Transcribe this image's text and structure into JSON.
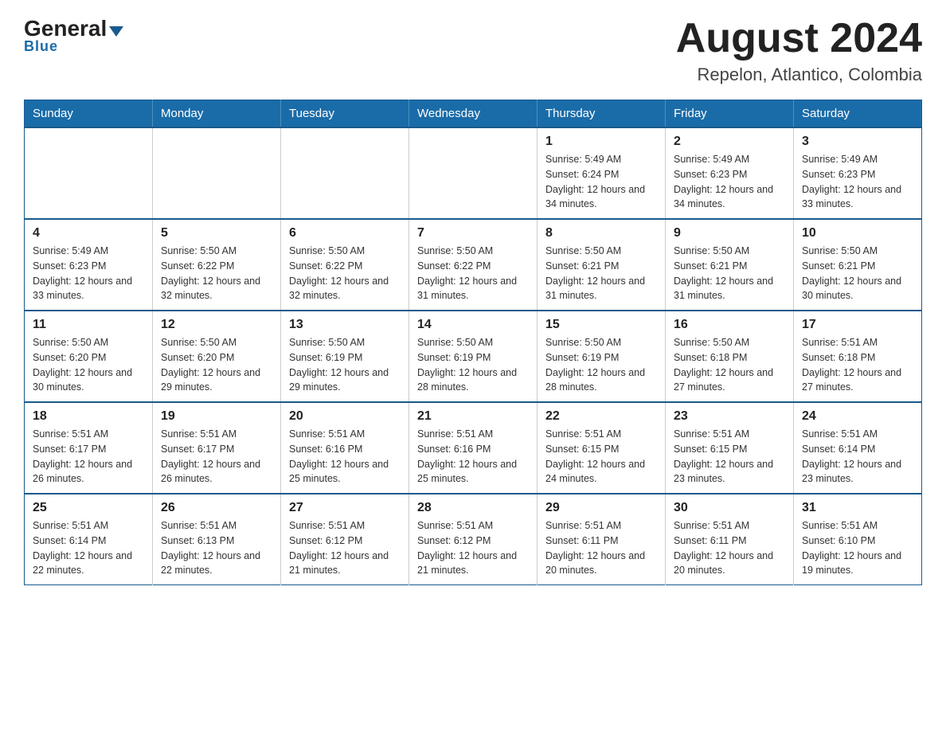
{
  "header": {
    "logo_general": "General",
    "logo_blue": "Blue",
    "month_title": "August 2024",
    "location": "Repelon, Atlantico, Colombia"
  },
  "weekdays": [
    "Sunday",
    "Monday",
    "Tuesday",
    "Wednesday",
    "Thursday",
    "Friday",
    "Saturday"
  ],
  "weeks": [
    [
      {
        "day": "",
        "sunrise": "",
        "sunset": "",
        "daylight": ""
      },
      {
        "day": "",
        "sunrise": "",
        "sunset": "",
        "daylight": ""
      },
      {
        "day": "",
        "sunrise": "",
        "sunset": "",
        "daylight": ""
      },
      {
        "day": "",
        "sunrise": "",
        "sunset": "",
        "daylight": ""
      },
      {
        "day": "1",
        "sunrise": "Sunrise: 5:49 AM",
        "sunset": "Sunset: 6:24 PM",
        "daylight": "Daylight: 12 hours and 34 minutes."
      },
      {
        "day": "2",
        "sunrise": "Sunrise: 5:49 AM",
        "sunset": "Sunset: 6:23 PM",
        "daylight": "Daylight: 12 hours and 34 minutes."
      },
      {
        "day": "3",
        "sunrise": "Sunrise: 5:49 AM",
        "sunset": "Sunset: 6:23 PM",
        "daylight": "Daylight: 12 hours and 33 minutes."
      }
    ],
    [
      {
        "day": "4",
        "sunrise": "Sunrise: 5:49 AM",
        "sunset": "Sunset: 6:23 PM",
        "daylight": "Daylight: 12 hours and 33 minutes."
      },
      {
        "day": "5",
        "sunrise": "Sunrise: 5:50 AM",
        "sunset": "Sunset: 6:22 PM",
        "daylight": "Daylight: 12 hours and 32 minutes."
      },
      {
        "day": "6",
        "sunrise": "Sunrise: 5:50 AM",
        "sunset": "Sunset: 6:22 PM",
        "daylight": "Daylight: 12 hours and 32 minutes."
      },
      {
        "day": "7",
        "sunrise": "Sunrise: 5:50 AM",
        "sunset": "Sunset: 6:22 PM",
        "daylight": "Daylight: 12 hours and 31 minutes."
      },
      {
        "day": "8",
        "sunrise": "Sunrise: 5:50 AM",
        "sunset": "Sunset: 6:21 PM",
        "daylight": "Daylight: 12 hours and 31 minutes."
      },
      {
        "day": "9",
        "sunrise": "Sunrise: 5:50 AM",
        "sunset": "Sunset: 6:21 PM",
        "daylight": "Daylight: 12 hours and 31 minutes."
      },
      {
        "day": "10",
        "sunrise": "Sunrise: 5:50 AM",
        "sunset": "Sunset: 6:21 PM",
        "daylight": "Daylight: 12 hours and 30 minutes."
      }
    ],
    [
      {
        "day": "11",
        "sunrise": "Sunrise: 5:50 AM",
        "sunset": "Sunset: 6:20 PM",
        "daylight": "Daylight: 12 hours and 30 minutes."
      },
      {
        "day": "12",
        "sunrise": "Sunrise: 5:50 AM",
        "sunset": "Sunset: 6:20 PM",
        "daylight": "Daylight: 12 hours and 29 minutes."
      },
      {
        "day": "13",
        "sunrise": "Sunrise: 5:50 AM",
        "sunset": "Sunset: 6:19 PM",
        "daylight": "Daylight: 12 hours and 29 minutes."
      },
      {
        "day": "14",
        "sunrise": "Sunrise: 5:50 AM",
        "sunset": "Sunset: 6:19 PM",
        "daylight": "Daylight: 12 hours and 28 minutes."
      },
      {
        "day": "15",
        "sunrise": "Sunrise: 5:50 AM",
        "sunset": "Sunset: 6:19 PM",
        "daylight": "Daylight: 12 hours and 28 minutes."
      },
      {
        "day": "16",
        "sunrise": "Sunrise: 5:50 AM",
        "sunset": "Sunset: 6:18 PM",
        "daylight": "Daylight: 12 hours and 27 minutes."
      },
      {
        "day": "17",
        "sunrise": "Sunrise: 5:51 AM",
        "sunset": "Sunset: 6:18 PM",
        "daylight": "Daylight: 12 hours and 27 minutes."
      }
    ],
    [
      {
        "day": "18",
        "sunrise": "Sunrise: 5:51 AM",
        "sunset": "Sunset: 6:17 PM",
        "daylight": "Daylight: 12 hours and 26 minutes."
      },
      {
        "day": "19",
        "sunrise": "Sunrise: 5:51 AM",
        "sunset": "Sunset: 6:17 PM",
        "daylight": "Daylight: 12 hours and 26 minutes."
      },
      {
        "day": "20",
        "sunrise": "Sunrise: 5:51 AM",
        "sunset": "Sunset: 6:16 PM",
        "daylight": "Daylight: 12 hours and 25 minutes."
      },
      {
        "day": "21",
        "sunrise": "Sunrise: 5:51 AM",
        "sunset": "Sunset: 6:16 PM",
        "daylight": "Daylight: 12 hours and 25 minutes."
      },
      {
        "day": "22",
        "sunrise": "Sunrise: 5:51 AM",
        "sunset": "Sunset: 6:15 PM",
        "daylight": "Daylight: 12 hours and 24 minutes."
      },
      {
        "day": "23",
        "sunrise": "Sunrise: 5:51 AM",
        "sunset": "Sunset: 6:15 PM",
        "daylight": "Daylight: 12 hours and 23 minutes."
      },
      {
        "day": "24",
        "sunrise": "Sunrise: 5:51 AM",
        "sunset": "Sunset: 6:14 PM",
        "daylight": "Daylight: 12 hours and 23 minutes."
      }
    ],
    [
      {
        "day": "25",
        "sunrise": "Sunrise: 5:51 AM",
        "sunset": "Sunset: 6:14 PM",
        "daylight": "Daylight: 12 hours and 22 minutes."
      },
      {
        "day": "26",
        "sunrise": "Sunrise: 5:51 AM",
        "sunset": "Sunset: 6:13 PM",
        "daylight": "Daylight: 12 hours and 22 minutes."
      },
      {
        "day": "27",
        "sunrise": "Sunrise: 5:51 AM",
        "sunset": "Sunset: 6:12 PM",
        "daylight": "Daylight: 12 hours and 21 minutes."
      },
      {
        "day": "28",
        "sunrise": "Sunrise: 5:51 AM",
        "sunset": "Sunset: 6:12 PM",
        "daylight": "Daylight: 12 hours and 21 minutes."
      },
      {
        "day": "29",
        "sunrise": "Sunrise: 5:51 AM",
        "sunset": "Sunset: 6:11 PM",
        "daylight": "Daylight: 12 hours and 20 minutes."
      },
      {
        "day": "30",
        "sunrise": "Sunrise: 5:51 AM",
        "sunset": "Sunset: 6:11 PM",
        "daylight": "Daylight: 12 hours and 20 minutes."
      },
      {
        "day": "31",
        "sunrise": "Sunrise: 5:51 AM",
        "sunset": "Sunset: 6:10 PM",
        "daylight": "Daylight: 12 hours and 19 minutes."
      }
    ]
  ]
}
